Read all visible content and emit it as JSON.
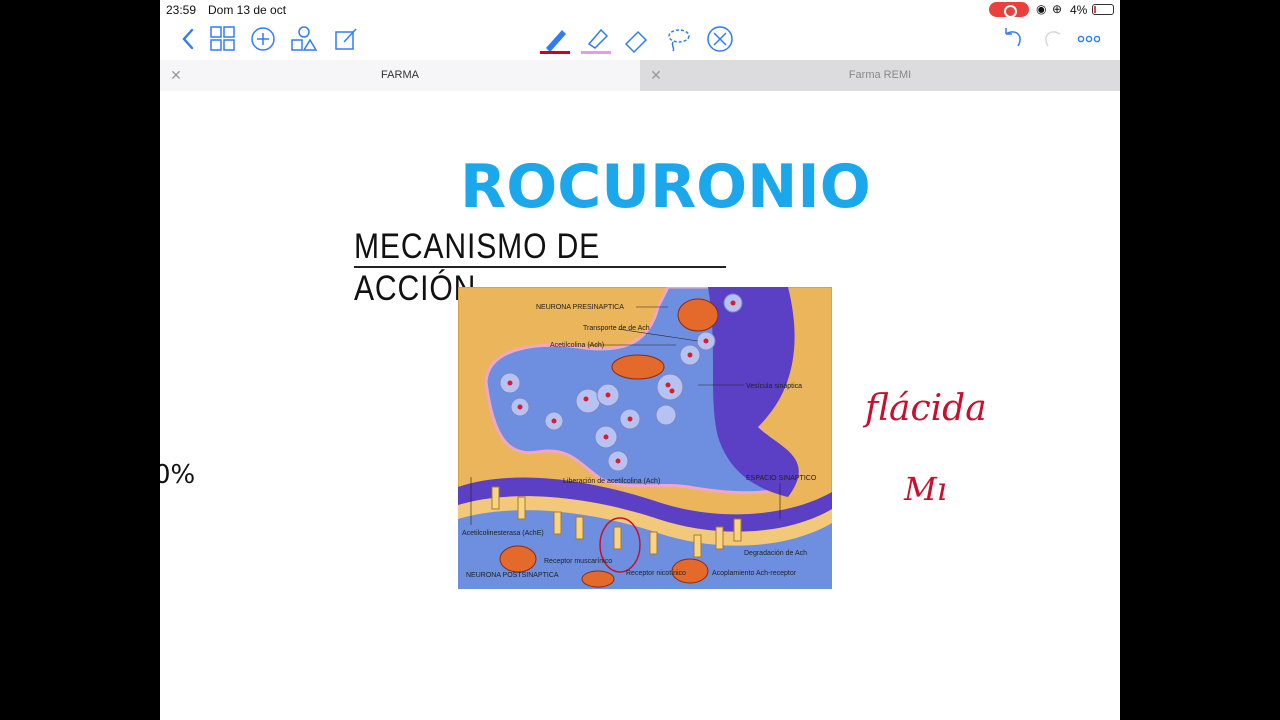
{
  "status": {
    "time": "23:59",
    "date": "Dom 13 de oct",
    "battery": "4%"
  },
  "tabs": [
    {
      "label": "FARMA",
      "active": true
    },
    {
      "label": "Farma REMI",
      "active": false
    }
  ],
  "page": {
    "title": "ROCURONIO",
    "subtitle": "MECANISMO DE ACCIÓN",
    "handwriting": [
      "flácida",
      "Mı"
    ],
    "edge_mark": "0%"
  },
  "figure": {
    "labels": {
      "presynaptic": "NEURONA PRESINAPTICA",
      "transport": "Transporte de de Ach",
      "acetylcholine": "Acetilcolina (Ach)",
      "vesicle": "Vesícula sináptica",
      "release": "Liberación de acetilcolina (Ach)",
      "cleft": "ESPACIO SINAPTICO",
      "ache": "Acetilcolinesterasa (AchE)",
      "degradation": "Degradación de Ach",
      "muscarinic": "Receptor muscarínico",
      "nicotinic": "Receptor nicotínico",
      "coupling": "Acoplamiento Ach-receptor",
      "postsynaptic": "NEURONA POSTSINAPTICA"
    }
  },
  "colors": {
    "title": "#1aa7ec",
    "ink": "#c8102e",
    "figure_bg": "#eab55b",
    "neuron": "#5b3fc4"
  }
}
